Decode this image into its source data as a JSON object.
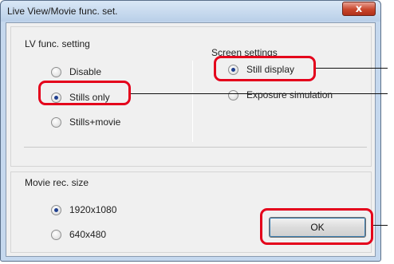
{
  "window": {
    "title": "Live View/Movie func. set.",
    "close_glyph": "x"
  },
  "lv_func": {
    "heading": "LV func. setting",
    "options": [
      "Disable",
      "Stills only",
      "Stills+movie"
    ],
    "selected": "Stills only"
  },
  "screen": {
    "heading": "Screen settings",
    "options": [
      "Still display",
      "Exposure simulation"
    ],
    "selected": "Still display"
  },
  "movie": {
    "heading": "Movie rec. size",
    "options": [
      "1920x1080",
      "640x480"
    ],
    "selected": "1920x1080"
  },
  "buttons": {
    "ok": "OK"
  },
  "colors": {
    "highlight": "#e4001b",
    "titlebar": "#c5d8ee",
    "close": "#c9462c"
  }
}
